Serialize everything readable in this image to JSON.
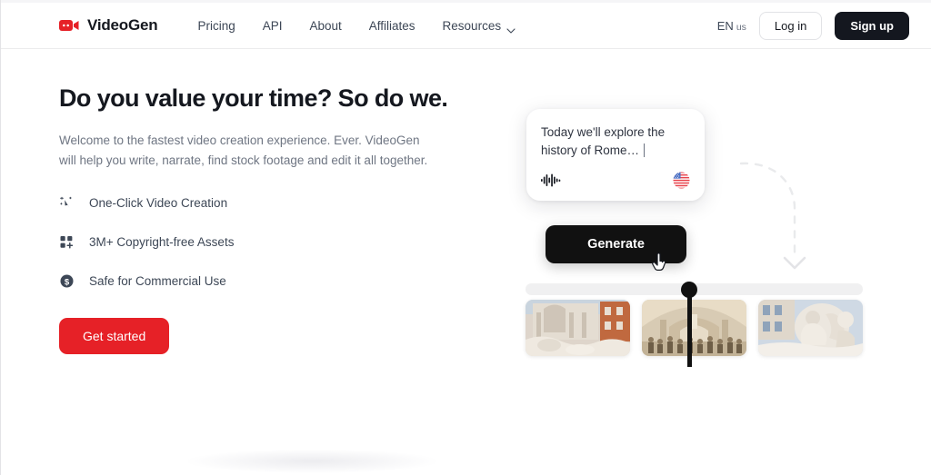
{
  "navbar": {
    "brand": {
      "name": "VideoGen",
      "icon": "video-camera-icon"
    },
    "links": [
      {
        "label": "Pricing"
      },
      {
        "label": "API"
      },
      {
        "label": "About"
      },
      {
        "label": "Affiliates"
      },
      {
        "label": "Resources",
        "caret": "chevron-down-icon"
      }
    ],
    "language": {
      "code": "EN",
      "region": "us"
    },
    "login_label": "Log in",
    "signup_label": "Sign up"
  },
  "hero": {
    "headline": "Do you value your time? So do we.",
    "subhead": "Welcome to the fastest video creation experience. Ever. VideoGen will help you write, narrate, find stock footage and edit it all together.",
    "features": [
      {
        "label": "One-Click Video Creation",
        "icon": "sparkle-cursor-icon"
      },
      {
        "label": "3M+ Copyright-free Assets",
        "icon": "grid-plus-icon"
      },
      {
        "label": "Safe for Commercial Use",
        "icon": "dollar-circle-icon"
      }
    ],
    "cta_label": "Get started"
  },
  "illustration": {
    "prompt_text": "Today we'll explore the history of Rome…",
    "waveform_icon": "audio-waveform-icon",
    "flag_icon": "us-flag-icon",
    "generate_label": "Generate",
    "cursor_icon": "pointing-hand-cursor-icon",
    "arrow_icon": "dashed-curved-arrow-icon",
    "thumbnails": [
      {
        "name": "trevi-fountain-thumbnail"
      },
      {
        "name": "school-of-athens-thumbnail"
      },
      {
        "name": "marble-statue-thumbnail"
      }
    ]
  },
  "colors": {
    "brand_red": "#e62127",
    "signup_dark": "#14171f",
    "generate_black": "#111111",
    "text_dark": "#15181f",
    "text_muted": "#6f7683"
  }
}
